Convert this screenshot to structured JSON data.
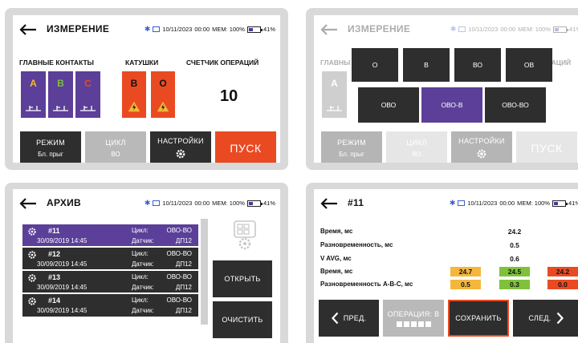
{
  "status": {
    "datetime": "10/11/2023",
    "time": "00:00",
    "mem": "MEM: 100%",
    "battery": "41%"
  },
  "colors": {
    "purple": "#5b3f99",
    "orange": "#ea4a22",
    "dark": "#2e2e2e",
    "grey": "#b9b9b9"
  },
  "measure": {
    "title": "ИЗМЕРЕНИЕ",
    "main_contacts_label": "ГЛАВНЫЕ КОНТАКТЫ",
    "coils_label": "КАТУШКИ",
    "counter_label": "СЧЕТЧИК ОПЕРАЦИЙ",
    "contacts": [
      {
        "letter": "A",
        "color": "#f4b73b"
      },
      {
        "letter": "B",
        "color": "#7ec13b"
      },
      {
        "letter": "C",
        "color": "#ea4a22"
      }
    ],
    "coils": [
      "В",
      "О"
    ],
    "counter_value": "10",
    "mode_button": {
      "label": "РЕЖИМ",
      "value": "Бл. прыг"
    },
    "cycle_button": {
      "label": "ЦИКЛ",
      "value": "ВО"
    },
    "settings_button": {
      "label": "НАСТРОЙКИ"
    },
    "start_button": "ПУСК"
  },
  "cycle_menu": {
    "row1": [
      "О",
      "В",
      "ВО",
      "ОВ"
    ],
    "row2": [
      "ОВО",
      "ОВО-В",
      "ОВО-ВО"
    ],
    "selected": "ОВО-В",
    "partial_label": "ГЛАВНЫ",
    "partial_label_right": "ЕРАЦИЙ"
  },
  "archive": {
    "title": "АРХИВ",
    "cycle_key": "Цикл:",
    "sensor_key": "Датчик:",
    "items": [
      {
        "id": "#11",
        "date": "30/09/2019 14:45",
        "cycle": "ОВО-ВО",
        "sensor": "ДП12"
      },
      {
        "id": "#12",
        "date": "30/09/2019 14:45",
        "cycle": "ОВО-ВО",
        "sensor": "ДП12"
      },
      {
        "id": "#13",
        "date": "30/09/2019 14:45",
        "cycle": "ОВО-ВО",
        "sensor": "ДП12"
      },
      {
        "id": "#14",
        "date": "30/09/2019 14:45",
        "cycle": "ОВО-ВО",
        "sensor": "ДП12"
      }
    ],
    "open_button": "ОТКРЫТЬ",
    "clear_button": "ОЧИСТИТЬ"
  },
  "record": {
    "title": "#11",
    "rows": [
      {
        "label": "Время, мс",
        "value": "24.2"
      },
      {
        "label": "Разновременность, мс",
        "value": "0.5"
      },
      {
        "label": "V AVG, мс",
        "value": "0.6"
      }
    ],
    "time_phase_label": "Время, мс",
    "time_phase": [
      "24.7",
      "24.5",
      "24.2"
    ],
    "diff_phase_label": "Разновременность A-B-C, мс",
    "diff_phase": [
      "0.5",
      "0.3",
      "0.0"
    ],
    "prev_button": "ПРЕД.",
    "operation_button": "ОПЕРАЦИЯ: В",
    "save_button": "СОХРАНИТЬ",
    "next_button": "СЛЕД."
  }
}
